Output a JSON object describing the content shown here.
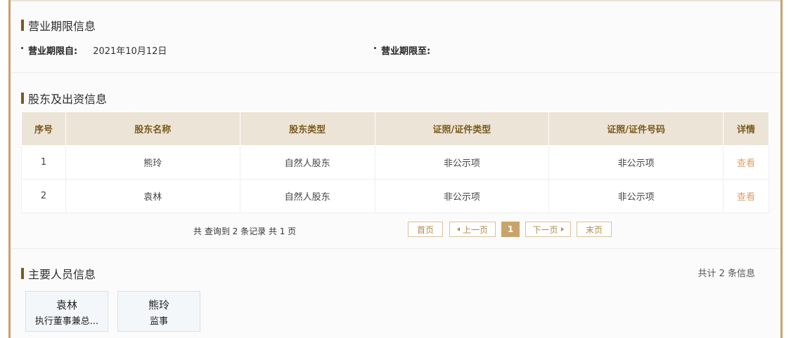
{
  "business_period": {
    "title": "营业期限信息",
    "from_label": "营业期限自:",
    "from_value": "2021年10月12日",
    "to_label": "营业期限至:",
    "to_value": ""
  },
  "shareholders": {
    "title": "股东及出资信息",
    "columns": [
      "序号",
      "股东名称",
      "股东类型",
      "证照/证件类型",
      "证照/证件号码",
      "详情"
    ],
    "rows": [
      {
        "no": "1",
        "name": "熊玲",
        "type": "自然人股东",
        "cert_type": "非公示项",
        "cert_no": "非公示项",
        "detail": "查看"
      },
      {
        "no": "2",
        "name": "袁林",
        "type": "自然人股东",
        "cert_type": "非公示项",
        "cert_no": "非公示项",
        "detail": "查看"
      }
    ],
    "pager": {
      "summary": "共 查询到 2 条记录 共 1 页",
      "first": "首页",
      "prev": "上一页",
      "current": "1",
      "next": "下一页",
      "last": "末页"
    }
  },
  "staff": {
    "title": "主要人员信息",
    "count_text": "共计 2 条信息",
    "people": [
      {
        "name": "袁林",
        "role": "执行董事兼总..."
      },
      {
        "name": "熊玲",
        "role": "监事"
      }
    ]
  },
  "colors": {
    "accent": "#c9a06a",
    "title_bar": "#7b5a1e",
    "header_bg": "#ece4d6",
    "link": "#d9a26a"
  }
}
